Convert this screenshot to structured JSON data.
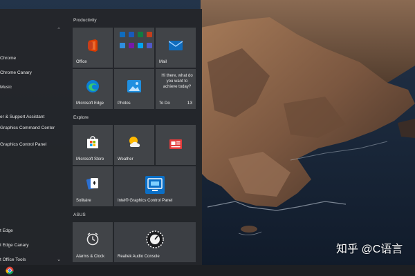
{
  "app_list": [
    {
      "label": "",
      "has_chevron": true
    },
    {
      "label": "Chrome"
    },
    {
      "label": "Chrome Canary"
    },
    {
      "label": "Music"
    },
    {
      "label": "er & Support Assistant"
    },
    {
      "label": "Graphics Command Center"
    },
    {
      "label": "Graphics Control Panel"
    },
    {
      "label": "t Edge"
    },
    {
      "label": "t Edge Canary"
    },
    {
      "label": "t Office Tools",
      "has_chevron": true
    }
  ],
  "groups": {
    "productivity": "Productivity",
    "explore": "Explore",
    "asus": "ASUS"
  },
  "tiles": {
    "office": "Office",
    "mail": "Mail",
    "microsoft_edge": "Microsoft Edge",
    "photos": "Photos",
    "todo_message": "Hi there, what do you want to achieve today?",
    "todo_label": "To Do",
    "todo_count": "13",
    "microsoft_store": "Microsoft Store",
    "weather": "Weather",
    "solitaire": "Solitaire",
    "intel_graphics": "Intel® Graphics Control Panel",
    "alarms_clock": "Alarms & Clock",
    "realtek_audio": "Realtek Audio Console"
  },
  "watermark": "知乎 @C语言",
  "colors": {
    "menu_bg": "#24262a",
    "tile_bg": "#414448",
    "taskbar_bg": "#1d1f23",
    "office_red": "#d83b01",
    "mail_blue": "#0f6cbd",
    "edge_blue": "#0c7fd6",
    "intel_blue": "#0b6fc6"
  }
}
